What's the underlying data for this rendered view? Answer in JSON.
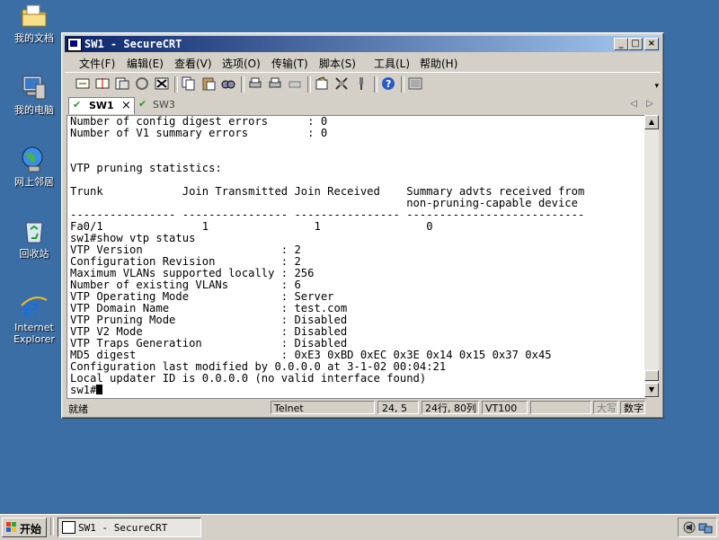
{
  "desktop": {
    "icons": [
      {
        "label": "我的文档",
        "icon": "folder-icon"
      },
      {
        "label": "我的电脑",
        "icon": "computer-icon"
      },
      {
        "label": "网上邻居",
        "icon": "network-icon"
      },
      {
        "label": "回收站",
        "icon": "recycle-bin-icon"
      },
      {
        "label1": "Internet",
        "label2": "Explorer",
        "icon": "internet-explorer-icon"
      }
    ]
  },
  "window": {
    "title": "SW1 - SecureCRT",
    "menu": [
      "文件(F)",
      "编辑(E)",
      "查看(V)",
      "选项(O)",
      "传输(T)",
      "脚本(S)",
      "工具(L)",
      "帮助(H)"
    ],
    "tabs": [
      {
        "label": "SW1",
        "active": true,
        "close": "×"
      },
      {
        "label": "SW3",
        "active": false
      }
    ],
    "terminal_lines": [
      "Number of config digest errors      : 0",
      "Number of V1 summary errors         : 0",
      "",
      "",
      "VTP pruning statistics:",
      "",
      "Trunk            Join Transmitted Join Received    Summary advts received from",
      "                                                   non-pruning-capable device",
      "---------------- ---------------- ---------------- ---------------------------",
      "Fa0/1               1                1                0",
      "sw1#show vtp status",
      "VTP Version                     : 2",
      "Configuration Revision          : 2",
      "Maximum VLANs supported locally : 256",
      "Number of existing VLANs        : 6",
      "VTP Operating Mode              : Server",
      "VTP Domain Name                 : test.com",
      "VTP Pruning Mode                : Disabled",
      "VTP V2 Mode                     : Disabled",
      "VTP Traps Generation            : Disabled",
      "MD5 digest                      : 0xE3 0xBD 0xEC 0x3E 0x14 0x15 0x37 0x45",
      "Configuration last modified by 0.0.0.0 at 3-1-02 00:04:21",
      "Local updater ID is 0.0.0.0 (no valid interface found)"
    ],
    "prompt": "sw1#",
    "status": {
      "ready": "就绪",
      "protocol": "Telnet",
      "cursor_pos": "24,  5",
      "size": "24行, 80列",
      "emulation": "VT100",
      "caps": "大写",
      "num": "数字"
    }
  },
  "taskbar": {
    "start_label": "开始",
    "task_label": "SW1 - SecureCRT"
  }
}
